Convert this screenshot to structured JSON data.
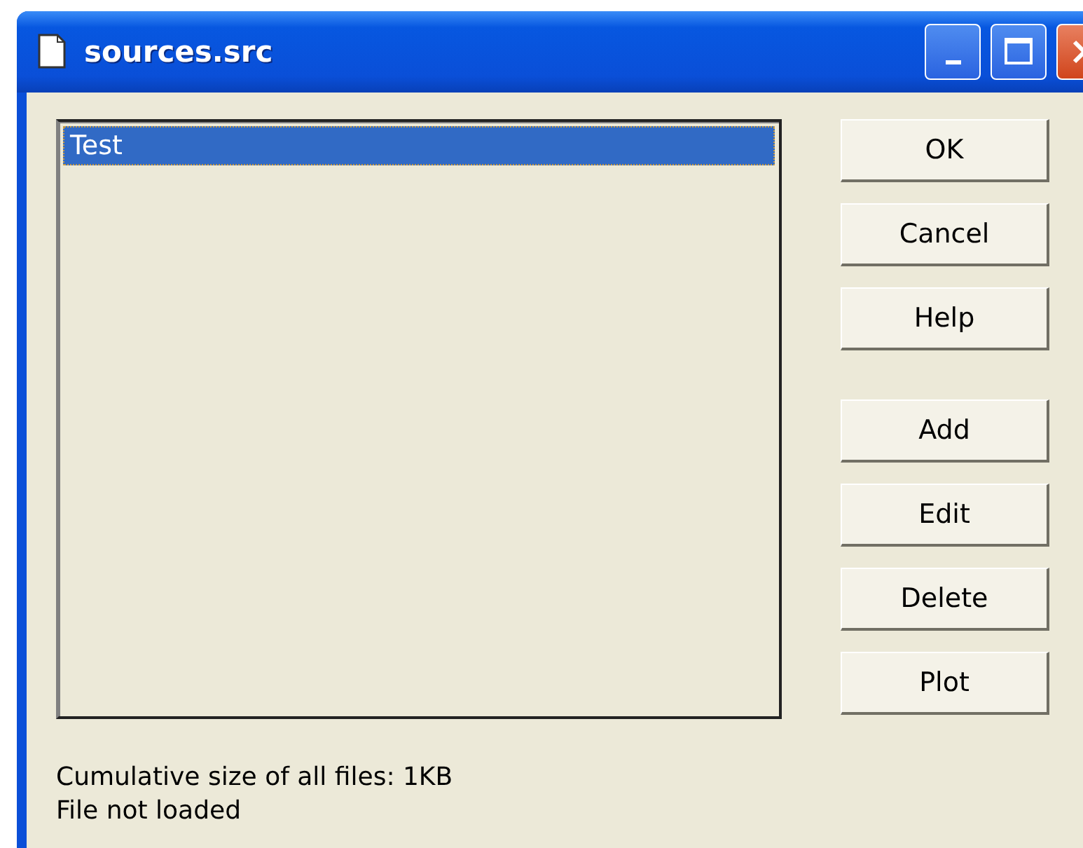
{
  "window": {
    "title": "sources.src"
  },
  "list": {
    "items": [
      {
        "label": "Test",
        "selected": true
      }
    ]
  },
  "button_groups": [
    [
      "OK",
      "Cancel",
      "Help"
    ],
    [
      "Add",
      "Edit",
      "Delete",
      "Plot"
    ]
  ],
  "status_lines": [
    "Cumulative size of all files: 1KB",
    "File not loaded"
  ]
}
